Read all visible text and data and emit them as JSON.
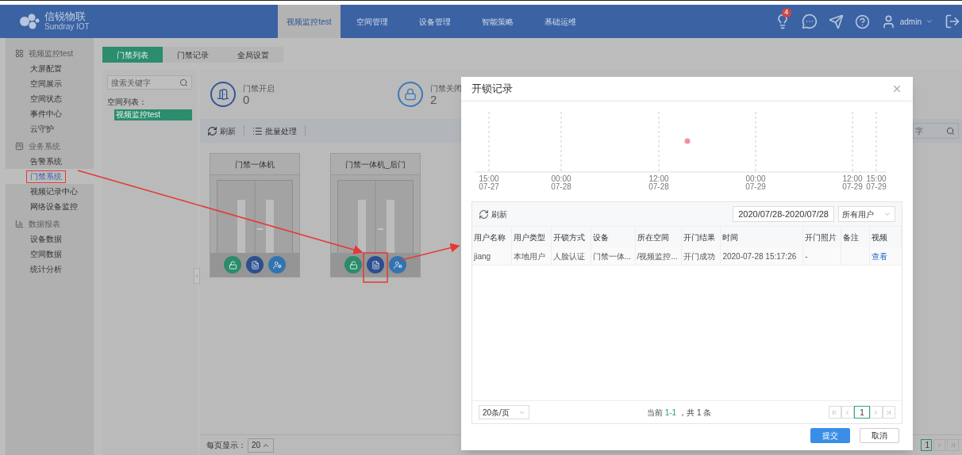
{
  "header": {
    "logo_name": "信锐物联",
    "logo_subtitle": "Sundray IOT",
    "nav": [
      {
        "label": "视频监控test",
        "selected": true
      },
      {
        "label": "空间管理",
        "selected": false
      },
      {
        "label": "设备管理",
        "selected": false
      },
      {
        "label": "智能策略",
        "selected": false
      },
      {
        "label": "基础运维",
        "selected": false
      }
    ],
    "notification_count": "4",
    "user": "admin"
  },
  "sidebar": [
    {
      "title": "视频监控test",
      "kind": "grid",
      "items": [
        {
          "label": "大屏配置",
          "selected": false
        },
        {
          "label": "空间展示",
          "selected": false
        },
        {
          "label": "空间状态",
          "selected": false
        },
        {
          "label": "事件中心",
          "selected": false
        },
        {
          "label": "云守护",
          "selected": false
        }
      ]
    },
    {
      "title": "业务系统",
      "kind": "business",
      "items": [
        {
          "label": "告警系统",
          "selected": false
        },
        {
          "label": "门禁系统",
          "selected": true
        },
        {
          "label": "视频记录中心",
          "selected": false
        },
        {
          "label": "网络设备监控",
          "selected": false
        }
      ]
    },
    {
      "title": "数据报表",
      "kind": "report",
      "items": [
        {
          "label": "设备数据",
          "selected": false
        },
        {
          "label": "空间数据",
          "selected": false
        },
        {
          "label": "统计分析",
          "selected": false
        }
      ]
    }
  ],
  "tabs": [
    {
      "label": "门禁列表",
      "selected": true
    },
    {
      "label": "门禁记录",
      "selected": false
    },
    {
      "label": "全局设置",
      "selected": false
    }
  ],
  "space_panel": {
    "search_placeholder": "搜索关键字",
    "list_label": "空间列表：",
    "spaces": [
      {
        "label": "视频监控test",
        "selected": true
      }
    ]
  },
  "stats": [
    {
      "label": "门禁开启",
      "value": "0",
      "kind": "door"
    },
    {
      "label": "门禁关闭",
      "value": "2",
      "kind": "lock"
    }
  ],
  "toolbar": {
    "refresh": "刷新",
    "batch": "批量处理",
    "search_visible": "字"
  },
  "doors": [
    {
      "name": "门禁一体机"
    },
    {
      "name": "门禁一体机_后门"
    }
  ],
  "page_size": {
    "label": "每页显示：",
    "value": "20"
  },
  "pager_page": "1",
  "dialog": {
    "title": "开锁记录",
    "timeline": [
      {
        "time": "15:00",
        "date": "07-27"
      },
      {
        "time": "00:00",
        "date": "07-28"
      },
      {
        "time": "12:00",
        "date": "07-28"
      },
      {
        "time": "00:00",
        "date": "07-29"
      },
      {
        "time": "12:00",
        "date": "07-29"
      },
      {
        "time": "15:00",
        "date": "07-29"
      }
    ],
    "refresh": "刷新",
    "date_range": "2020/07/28-2020/07/28",
    "user_filter": "所有用户",
    "columns": [
      "用户名称",
      "用户类型",
      "开锁方式",
      "设备",
      "所在空间",
      "开门结果",
      "时间",
      "开门照片",
      "备注",
      "视频"
    ],
    "rows": [
      {
        "cells": [
          "jiang",
          "本地用户",
          "人脸认证",
          "门禁一体...",
          "/视频监控...",
          "开门成功",
          "2020-07-28 15:17:26",
          "-"
        ],
        "video_link": "查看"
      }
    ],
    "page_size": "20条/页",
    "summary_prefix": "当前",
    "summary_range": "1-1",
    "summary_suffix": "，共 1 条",
    "current_page": "1",
    "buttons": [
      {
        "label": "提交",
        "kind": "primary"
      },
      {
        "label": "取消",
        "kind": "default"
      }
    ]
  }
}
